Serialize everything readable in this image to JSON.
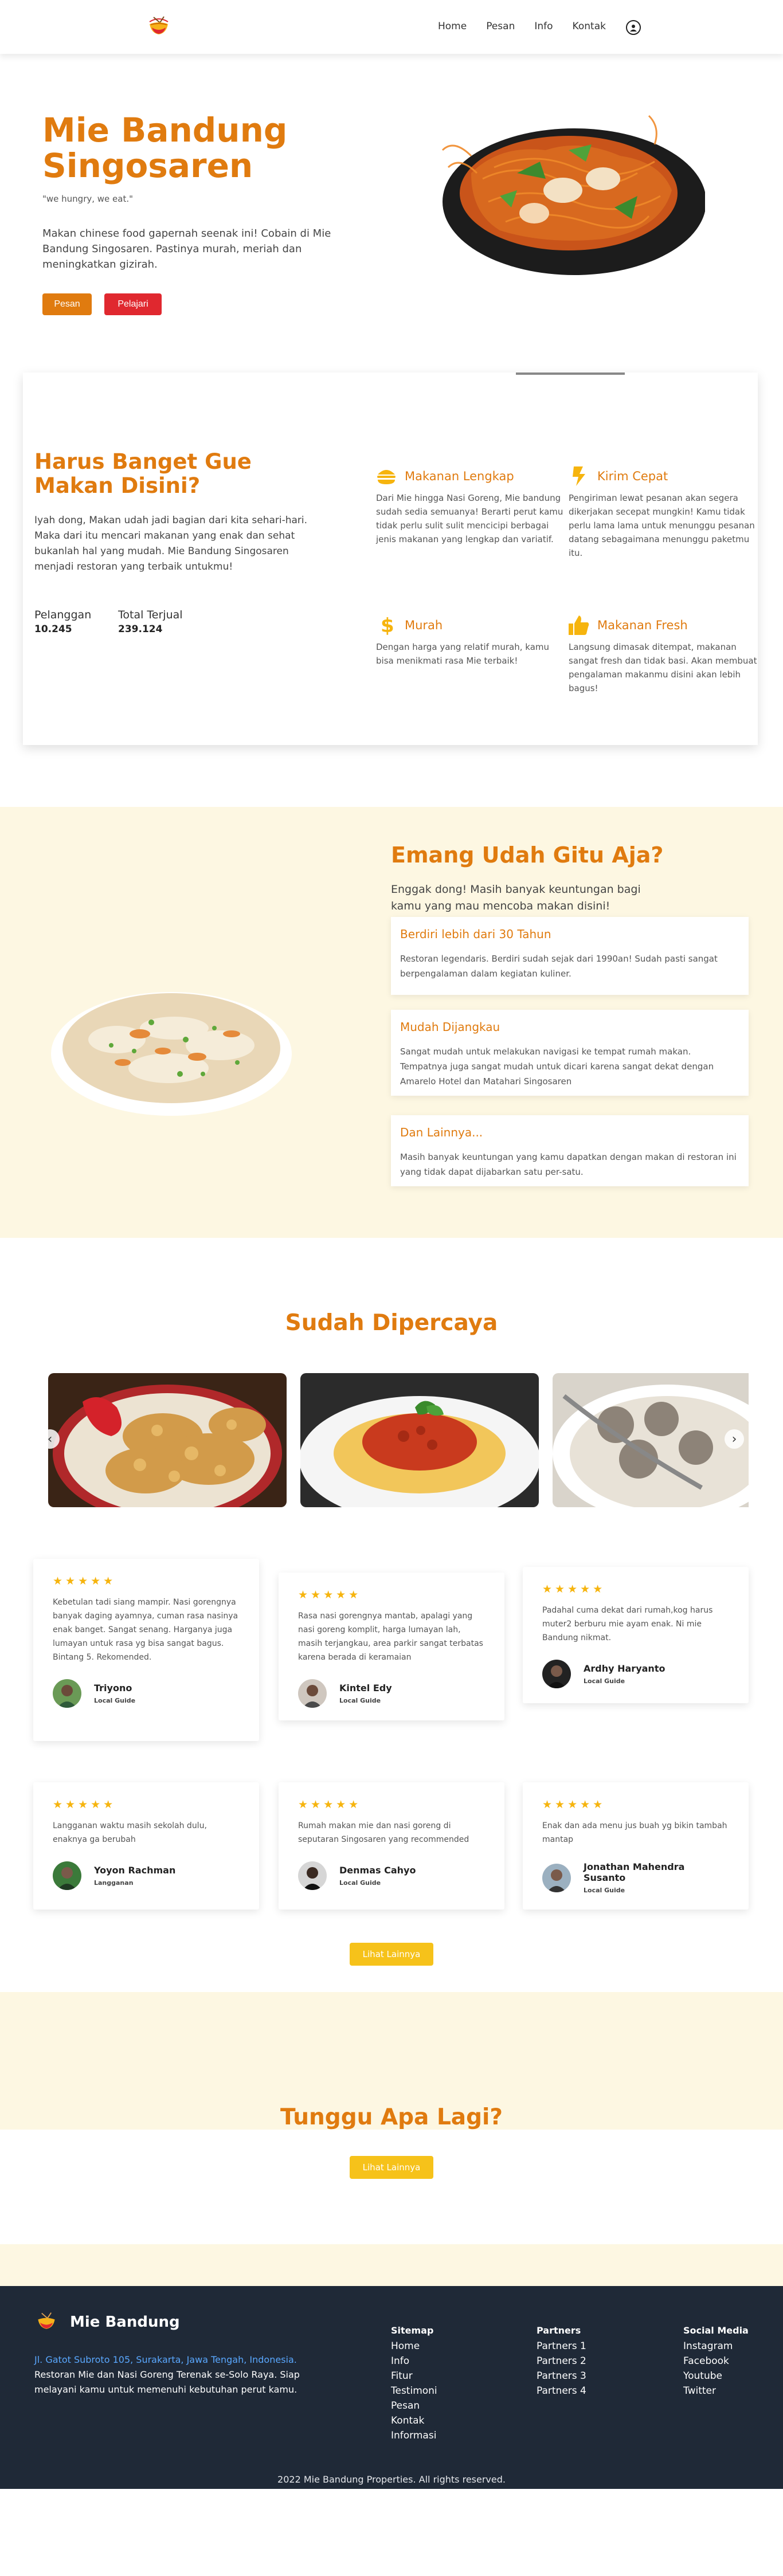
{
  "nav": {
    "items": [
      "Home",
      "Pesan",
      "Info",
      "Kontak"
    ]
  },
  "hero": {
    "title": "Mie Bandung Singosaren",
    "slogan": "\"we hungry, we eat.\"",
    "description": "Makan chinese food gapernah seenak ini! Cobain di Mie Bandung Singosaren. Pastinya murah, meriah dan meningkatkan gizirah.",
    "order_label": "Pesan",
    "learn_label": "Pelajari"
  },
  "why": {
    "heading": "Harus Banget Gue Makan Disini?",
    "paragraph": "Iyah dong, Makan udah jadi bagian dari kita sehari-hari. Maka dari itu mencari makanan yang enak dan sehat bukanlah hal yang mudah. Mie Bandung Singosaren menjadi restoran yang terbaik untukmu!",
    "stats": [
      {
        "label": "Pelanggan",
        "value": "10.245"
      },
      {
        "label": "Total Terjual",
        "value": "239.124"
      }
    ],
    "features": [
      {
        "title": "Makanan Lengkap",
        "icon": "burger-icon",
        "text": "Dari Mie hingga Nasi Goreng, Mie bandung sudah sedia semuanya! Berarti perut kamu tidak perlu sulit sulit mencicipi berbagai jenis makanan yang lengkap dan variatif."
      },
      {
        "title": "Kirim Cepat",
        "icon": "lightning-icon",
        "text": "Pengiriman lewat pesanan akan segera dikerjakan secepat mungkin! Kamu tidak perlu lama lama untuk menunggu pesanan datang sebagaimana menunggu paketmu itu."
      },
      {
        "title": "Murah",
        "icon": "dollar-icon",
        "text": "Dengan harga yang relatif murah, kamu bisa menikmati rasa Mie terbaik!"
      },
      {
        "title": "Makanan Fresh",
        "icon": "thumbs-up-icon",
        "text": "Langsung dimasak ditempat, makanan sangat fresh dan tidak basi. Akan membuat pengalaman makanmu disini akan lebih bagus!"
      }
    ]
  },
  "emang": {
    "title": "Emang Udah Gitu Aja?",
    "lead": "Enggak dong! Masih banyak keuntungan bagi kamu yang mau mencoba makan disini!",
    "cards": [
      {
        "title": "Berdiri lebih dari 30 Tahun",
        "text": "Restoran legendaris. Berdiri sudah sejak dari 1990an! Sudah pasti sangat berpengalaman dalam kegiatan kuliner."
      },
      {
        "title": "Mudah Dijangkau",
        "text": "Sangat mudah untuk melakukan navigasi ke tempat rumah makan. Tempatnya juga sangat mudah untuk dicari karena sangat dekat dengan Amarelo Hotel dan Matahari Singosaren"
      },
      {
        "title": "Dan Lainnya...",
        "text": "Masih banyak keuntungan yang kamu dapatkan dengan makan di restoran ini yang tidak dapat dijabarkan satu per-satu."
      }
    ]
  },
  "trust": {
    "title": "Sudah Dipercaya",
    "reviews": [
      {
        "stars": "★★★★★",
        "text": "Kebetulan tadi siang mampir. Nasi gorengnya banyak daging ayamnya, cuman rasa nasinya enak banget. Sangat senang. Harganya juga lumayan untuk rasa yg bisa sangat bagus. Bintang 5. Rekomended.",
        "name": "Triyono",
        "role": "Local Guide"
      },
      {
        "stars": "★★★★★",
        "text": "Rasa nasi gorengnya mantab, apalagi yang nasi goreng komplit, harga lumayan lah, masih terjangkau, area parkir sangat terbatas karena berada di keramaian",
        "name": "Kintel Edy",
        "role": "Local Guide"
      },
      {
        "stars": "★★★★★",
        "text": "Padahal cuma dekat dari rumah,kog harus muter2 berburu mie ayam enak. Ni mie Bandung nikmat.",
        "name": "Ardhy Haryanto",
        "role": "Local Guide"
      },
      {
        "stars": "★★★★★",
        "text": "Langganan waktu masih sekolah dulu, enaknya ga berubah",
        "name": "Yoyon Rachman",
        "role": "Langganan"
      },
      {
        "stars": "★★★★★",
        "text": "Rumah makan mie dan nasi goreng di seputaran Singosaren yang recommended",
        "name": "Denmas Cahyo",
        "role": "Local Guide"
      },
      {
        "stars": "★★★★★",
        "text": "Enak dan ada menu jus buah yg bikin tambah mantap",
        "name": "Jonathan Mahendra Susanto",
        "role": "Local Guide"
      }
    ],
    "more_label": "Lihat Lainnya"
  },
  "cta": {
    "title": "Tunggu Apa Lagi?",
    "more_label": "Lihat Lainnya"
  },
  "footer": {
    "brand": "Mie Bandung",
    "address": "Jl. Gatot Subroto 105, Surakarta, Jawa Tengah, Indonesia.",
    "tagline": "Restoran Mie dan Nasi Goreng Terenak se-Solo Raya. Siap melayani kamu untuk memenuhi kebutuhan perut kamu.",
    "columns": [
      {
        "heading": "Sitemap",
        "items": [
          "Home",
          "Info",
          "Fitur",
          "Testimoni",
          "Pesan",
          "Kontak",
          "Informasi"
        ]
      },
      {
        "heading": "Partners",
        "items": [
          "Partners 1",
          "Partners 2",
          "Partners 3",
          "Partners 4"
        ]
      },
      {
        "heading": "Social Media",
        "items": [
          "Instagram",
          "Facebook",
          "Youtube",
          "Twitter"
        ]
      }
    ],
    "copyright": "2022 Mie Bandung Properties. All rights reserved."
  }
}
